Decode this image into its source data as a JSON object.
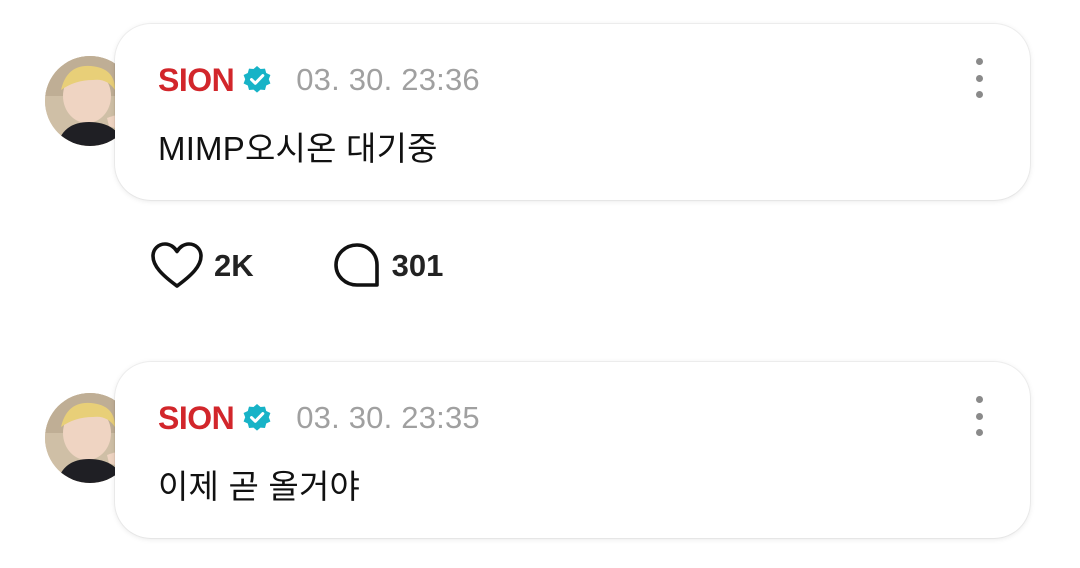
{
  "posts": [
    {
      "author": "SION",
      "timestamp": "03. 30. 23:36",
      "message": "MIMP오시온 대기중",
      "likes": "2K",
      "comments": "301"
    },
    {
      "author": "SION",
      "timestamp": "03. 30. 23:35",
      "message": "이제 곧 올거야"
    }
  ],
  "colors": {
    "author": "#d2262b",
    "verified_badge": "#17b3c7",
    "timestamp": "#a0a0a0",
    "text": "#111111"
  },
  "icons": {
    "verified": "verified-badge-icon",
    "more": "more-vertical-icon",
    "like": "heart-icon",
    "comment": "comment-bubble-icon"
  }
}
